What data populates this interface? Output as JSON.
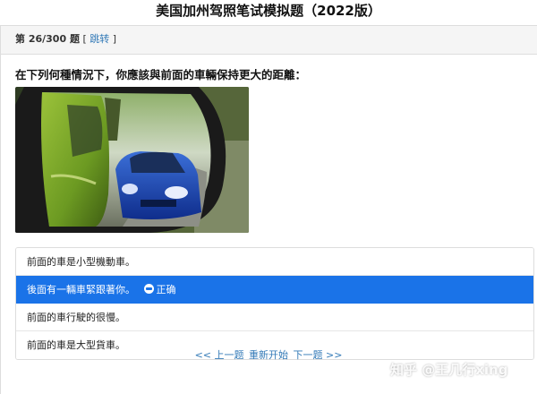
{
  "page": {
    "title": "美国加州驾照笔试模拟题（2022版）"
  },
  "header": {
    "question_number": "第 26/300 题",
    "bracket_open": "[",
    "jump_label": "跳转",
    "bracket_close": "]"
  },
  "question": {
    "text": "在下列何種情況下，你應該與前面的車輛保持更大的距離："
  },
  "options": [
    {
      "text": "前面的車是小型機動車。",
      "selected": false
    },
    {
      "text": "後面有一輛車緊跟著你。",
      "selected": true,
      "mark_label": "正确"
    },
    {
      "text": "前面的車行駛的很慢。",
      "selected": false
    },
    {
      "text": "前面的車是大型貨車。",
      "selected": false
    }
  ],
  "nav": {
    "prev": "<< 上一题",
    "restart": "重新开始",
    "next": "下一题 >>"
  },
  "watermark": {
    "text": "知乎 @王几行xing"
  },
  "colors": {
    "selected_bg": "#1a73e8",
    "link": "#337ab7",
    "header_bg": "#f5f5f5"
  }
}
